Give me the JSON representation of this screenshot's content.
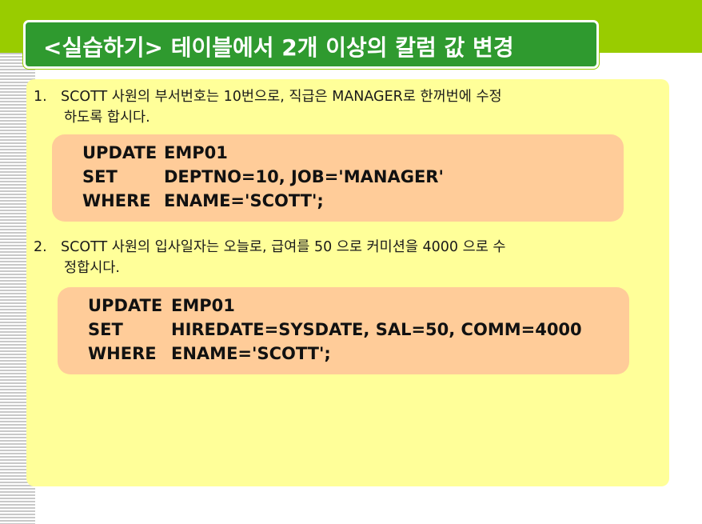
{
  "title": "<실습하기> 테이블에서 2개 이상의 칼럼 값 변경",
  "items": [
    {
      "number": "1.",
      "text_line1": "SCOTT 사원의 부서번호는 10번으로, 직급은 MANAGER로 한꺼번에 수정",
      "text_line2": "하도록 합시다.",
      "code": {
        "line1_kw": "UPDATE",
        "line1_val": "EMP01",
        "line2_kw": "SET",
        "line2_val": "DEPTNO=10, JOB='MANAGER'",
        "line3_kw": "WHERE",
        "line3_val": "ENAME='SCOTT';"
      }
    },
    {
      "number": "2.",
      "text_line1": "SCOTT 사원의 입사일자는 오늘로, 급여를 50 으로 커미션을 4000 으로 수",
      "text_line2": "정합시다.",
      "code": {
        "line1_kw": "UPDATE",
        "line1_val": "EMP01",
        "line2_kw": "SET",
        "line2_val": "HIREDATE=SYSDATE, SAL=50, COMM=4000",
        "line3_kw": "WHERE",
        "line3_val": "ENAME='SCOTT';"
      }
    }
  ],
  "colors": {
    "band": "#99cc00",
    "title_bg": "#2f9a2f",
    "panel_bg": "#ffff99",
    "code_bg": "#ffcc99"
  }
}
